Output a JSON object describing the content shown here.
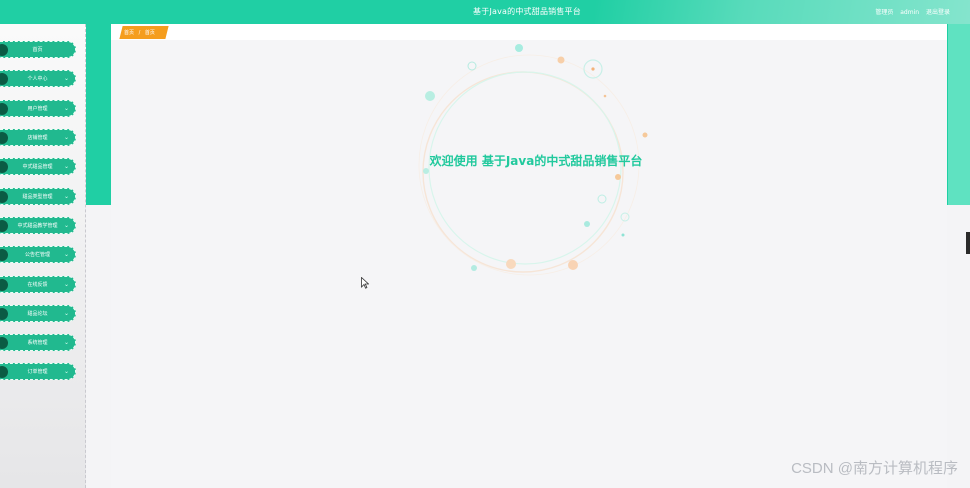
{
  "header": {
    "title": "基于Java的中式甜品销售平台",
    "user_role": "管理员",
    "user_name": "admin",
    "logout_label": "退出登录"
  },
  "breadcrumb": {
    "home": "首页",
    "separator": "/",
    "current": "首页"
  },
  "sidebar": {
    "items": [
      {
        "label": "首页",
        "has_chevron": false
      },
      {
        "label": "个人中心",
        "has_chevron": true
      },
      {
        "label": "用户管理",
        "has_chevron": true
      },
      {
        "label": "店铺管理",
        "has_chevron": true
      },
      {
        "label": "中式甜品管理",
        "has_chevron": true
      },
      {
        "label": "甜品类型管理",
        "has_chevron": true
      },
      {
        "label": "中式甜品教学管理",
        "has_chevron": true
      },
      {
        "label": "公告栏管理",
        "has_chevron": true
      },
      {
        "label": "在线反馈",
        "has_chevron": true
      },
      {
        "label": "甜品论坛",
        "has_chevron": true
      },
      {
        "label": "系统管理",
        "has_chevron": true
      },
      {
        "label": "订单管理",
        "has_chevron": true
      }
    ]
  },
  "welcome": {
    "text": "欢迎使用 基于Java的中式甜品销售平台"
  },
  "watermark": "CSDN @南方计算机程序",
  "colors": {
    "primary": "#20cfa4",
    "sidebar_item": "#21b98f",
    "accent_orange": "#f59d1d",
    "welcome_text": "#21c99d"
  },
  "icons": {
    "nav_chevron": "chevron-down-icon",
    "pointer": "mouse-pointer-icon"
  }
}
